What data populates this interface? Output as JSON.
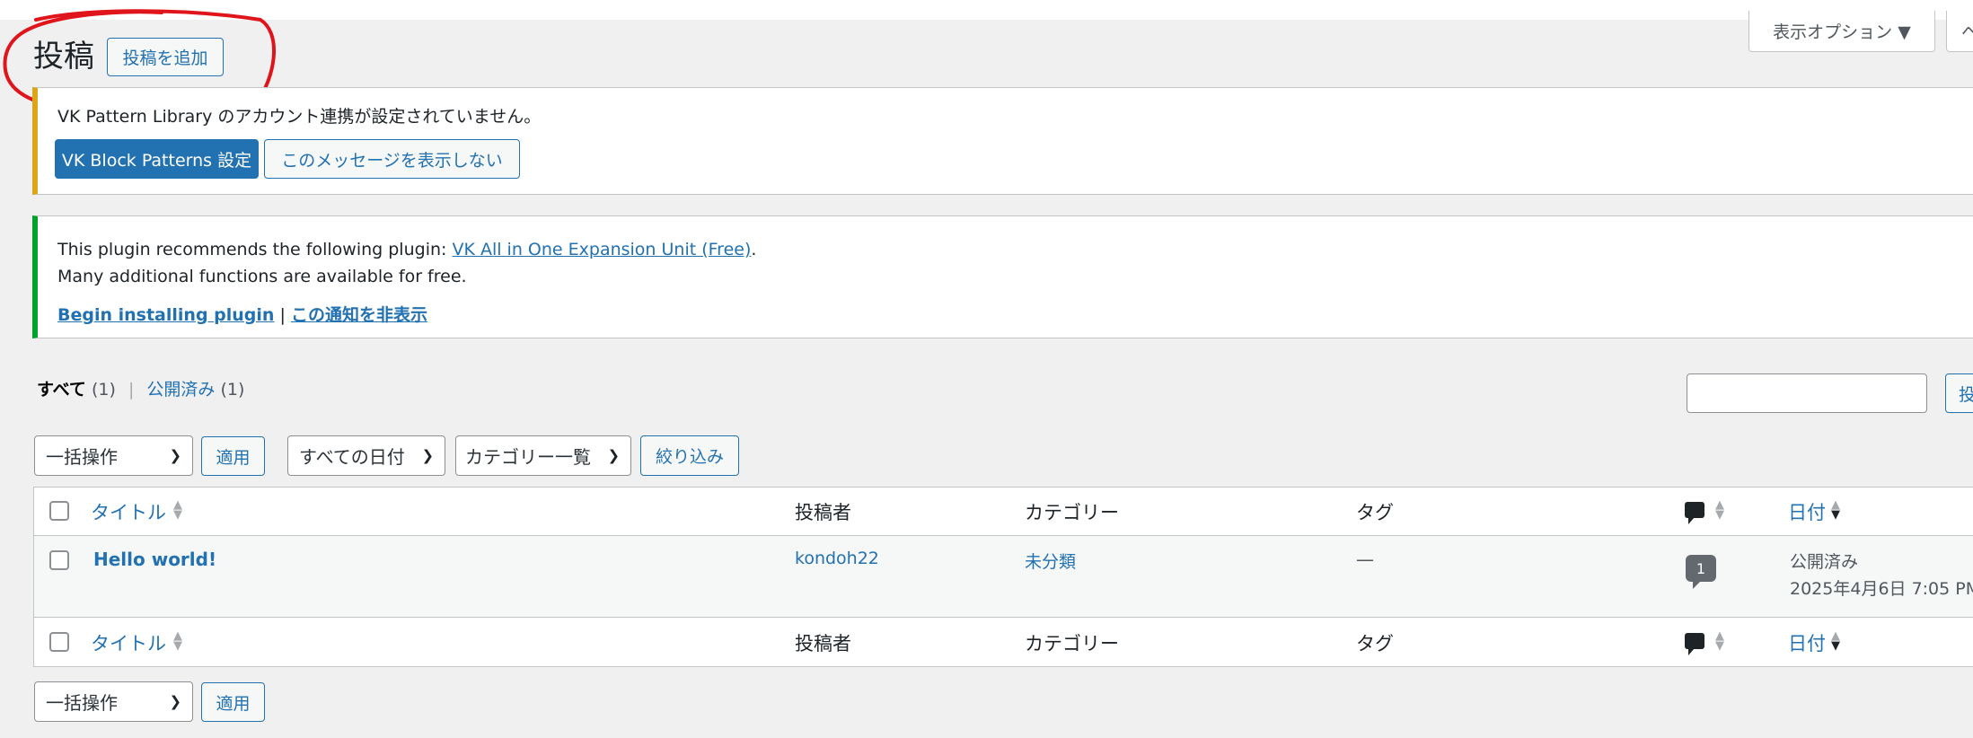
{
  "header": {
    "page_title": "投稿",
    "add_new_label": "投稿を追加",
    "screen_options_label": "表示オプション ▼",
    "help_label": "ヘ"
  },
  "notices": {
    "pattern_library": {
      "message": "VK Pattern Library のアカウント連携が設定されていません。",
      "settings_button": "VK Block Patterns 設定",
      "dismiss_button": "このメッセージを表示しない"
    },
    "plugin": {
      "line1_prefix": "This plugin recommends the following plugin: ",
      "plugin_link": "VK All in One Expansion Unit (Free)",
      "line1_suffix": ".",
      "line2": "Many additional functions are available for free.",
      "install_link": "Begin installing plugin",
      "separator": "|",
      "hide_link": "この通知を非表示"
    }
  },
  "views": {
    "all_label": "すべて",
    "all_count": "(1)",
    "separator": "|",
    "published_label": "公開済み",
    "published_count": "(1)"
  },
  "search": {
    "placeholder": "",
    "button_label": "投"
  },
  "filters": {
    "bulk_action": "一括操作",
    "apply": "適用",
    "dates": "すべての日付",
    "categories": "カテゴリー一覧",
    "filter_button": "絞り込み"
  },
  "table": {
    "columns": {
      "title": "タイトル",
      "author": "投稿者",
      "categories": "カテゴリー",
      "tags": "タグ",
      "date": "日付"
    },
    "rows": [
      {
        "title": "Hello world!",
        "author": "kondoh22",
        "category": "未分類",
        "tags": "—",
        "comments": "1",
        "status": "公開済み",
        "date": "2025年4月6日 7:05 PM"
      }
    ]
  },
  "bottom_filters": {
    "bulk_action": "一括操作",
    "apply": "適用"
  },
  "colors": {
    "accent": "#2271b1",
    "warning_border": "#dba617",
    "success_border": "#00a32a",
    "annotation": "#e0151b"
  },
  "icons": [
    "comment-icon",
    "sort-icon",
    "chevron-down-icon",
    "checkbox"
  ]
}
